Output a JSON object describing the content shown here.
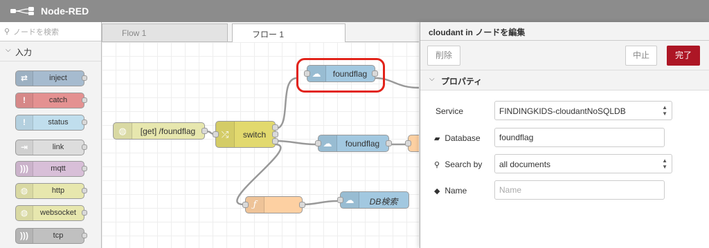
{
  "app": {
    "title": "Node-RED"
  },
  "palette": {
    "search_placeholder": "ノードを検索",
    "category": "入力",
    "nodes": [
      {
        "label": "inject",
        "color": "#a6bbcf",
        "icon": "arrow-icon",
        "glyph": "⇄"
      },
      {
        "label": "catch",
        "color": "#e49191",
        "icon": "alert-icon",
        "glyph": "!"
      },
      {
        "label": "status",
        "color": "#c0deed",
        "icon": "alert-icon",
        "glyph": "!"
      },
      {
        "label": "link",
        "color": "#dddddd",
        "icon": "link-icon",
        "glyph": "⇥"
      },
      {
        "label": "mqtt",
        "color": "#d8bfd8",
        "icon": "bridge-icon",
        "glyph": ")))"
      },
      {
        "label": "http",
        "color": "#e7e7ae",
        "icon": "globe-icon",
        "glyph": "◍"
      },
      {
        "label": "websocket",
        "color": "#e7e7ae",
        "icon": "globe-icon",
        "glyph": "◍"
      },
      {
        "label": "tcp",
        "color": "#c0c0c0",
        "icon": "bridge-icon",
        "glyph": ")))"
      }
    ]
  },
  "workspace": {
    "tabs": [
      {
        "label": "Flow 1"
      },
      {
        "label": "フロー 1"
      }
    ],
    "nodes": {
      "http_in": "[get] /foundflag",
      "switch": "switch",
      "cloudant_top": "foundflag",
      "cloudant_mid": "foundflag",
      "function": "",
      "db_search": "DB検索"
    }
  },
  "editor": {
    "title": "cloudant in ノードを編集",
    "delete_label": "削除",
    "cancel_label": "中止",
    "done_label": "完了",
    "section_label": "プロパティ",
    "fields": {
      "service": {
        "label": "Service",
        "value": "FINDINGKIDS-cloudantNoSQLDB"
      },
      "database": {
        "label": "Database",
        "value": "foundflag"
      },
      "search_by": {
        "label": "Search by",
        "value": "all documents"
      },
      "name": {
        "label": "Name",
        "value": "",
        "placeholder": "Name"
      }
    }
  },
  "colors": {
    "header": "#8c8c8c",
    "done_button": "#ad1625",
    "cloudant_node": "#a2c8e0",
    "http_node": "#e7e7ae",
    "switch_node": "#e2d96e",
    "function_node": "#fdd0a2",
    "highlight": "#e2231a"
  }
}
